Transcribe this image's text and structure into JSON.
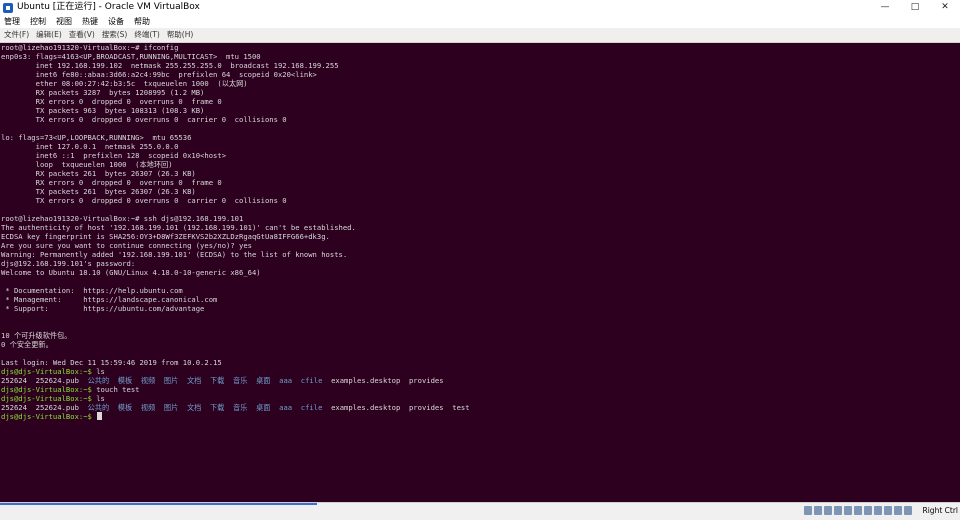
{
  "window": {
    "title": "Ubuntu [正在运行] - Oracle VM VirtualBox",
    "minimize": "—",
    "maximize": "□",
    "close": "✕"
  },
  "menubar": {
    "items": [
      "管理",
      "控制",
      "视图",
      "热键",
      "设备",
      "帮助"
    ]
  },
  "terminal_menu": {
    "items": [
      "文件(F)",
      "编辑(E)",
      "查看(V)",
      "搜索(S)",
      "终端(T)",
      "帮助(H)"
    ]
  },
  "terminal": {
    "lines": [
      "root@lizehao191320-VirtualBox:~# ifconfig",
      "enp0s3: flags=4163<UP,BROADCAST,RUNNING,MULTICAST>  mtu 1500",
      "        inet 192.168.199.102  netmask 255.255.255.0  broadcast 192.168.199.255",
      "        inet6 fe80::abaa:3d66:a2c4:99bc  prefixlen 64  scopeid 0x20<link>",
      "        ether 08:00:27:42:b3:5c  txqueuelen 1000  (以太网)",
      "        RX packets 3287  bytes 1208995 (1.2 MB)",
      "        RX errors 0  dropped 0  overruns 0  frame 0",
      "        TX packets 963  bytes 108313 (108.3 KB)",
      "        TX errors 0  dropped 0 overruns 0  carrier 0  collisions 0",
      "",
      "lo: flags=73<UP,LOOPBACK,RUNNING>  mtu 65536",
      "        inet 127.0.0.1  netmask 255.0.0.0",
      "        inet6 ::1  prefixlen 128  scopeid 0x10<host>",
      "        loop  txqueuelen 1000  (本地环回)",
      "        RX packets 261  bytes 26307 (26.3 KB)",
      "        RX errors 0  dropped 0  overruns 0  frame 0",
      "        TX packets 261  bytes 26307 (26.3 KB)",
      "        TX errors 0  dropped 0 overruns 0  carrier 0  collisions 0",
      "",
      "root@lizehao191320-VirtualBox:~# ssh djs@192.168.199.101",
      "The authenticity of host '192.168.199.101 (192.168.199.101)' can't be established.",
      "ECDSA key fingerprint is SHA256:OY3+D8Wf3ZEFKVS2b2XZLDzRgaqGtUa8IFFG66+dk3g.",
      "Are you sure you want to continue connecting (yes/no)? yes",
      "Warning: Permanently added '192.168.199.101' (ECDSA) to the list of known hosts.",
      "djs@192.168.199.101's password:",
      "Welcome to Ubuntu 18.10 (GNU/Linux 4.18.0-10-generic x86_64)",
      "",
      " * Documentation:  https://help.ubuntu.com",
      " * Management:     https://landscape.canonical.com",
      " * Support:        https://ubuntu.com/advantage",
      "",
      "",
      "10 个可升级软件包。",
      "0 个安全更新。",
      "",
      "Last login: Wed Dec 11 15:59:46 2019 from 10.0.2.15"
    ],
    "prompt": "djs@djs-VirtualBox:~$",
    "commands": [
      " ls",
      " touch test",
      " ls",
      " "
    ],
    "ls1": {
      "plain": [
        "252624",
        "252624.pub"
      ],
      "dirs": [
        "公共的",
        "模板",
        "视频",
        "图片",
        "文档",
        "下载",
        "音乐",
        "桌面",
        "aaa",
        "cfile"
      ],
      "files": [
        "examples.desktop",
        "provides"
      ]
    },
    "ls2": {
      "plain": [
        "252624",
        "252624.pub"
      ],
      "dirs": [
        "公共的",
        "模板",
        "视频",
        "图片",
        "文档",
        "下载",
        "音乐",
        "桌面",
        "aaa",
        "cfile"
      ],
      "files": [
        "examples.desktop",
        "provides",
        "test"
      ]
    }
  },
  "statusbar": {
    "host_key": "Right Ctrl",
    "progress_percent": 33
  }
}
